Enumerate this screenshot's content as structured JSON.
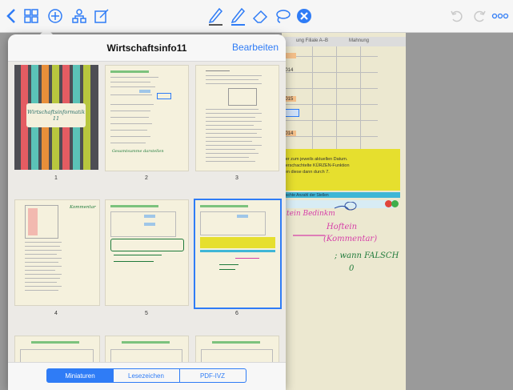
{
  "popover": {
    "title": "Wirtschaftsinfo11",
    "edit_label": "Bearbeiten",
    "tabs": [
      "Miniaturen",
      "Lesezeichen",
      "PDF-IVZ"
    ],
    "selected_tab": "Miniaturen",
    "pages": [
      {
        "number": "1",
        "cover_text": "Wirtschaftsinformatik 11"
      },
      {
        "number": "2",
        "note": "Gesamtsumme darstellen"
      },
      {
        "number": "3"
      },
      {
        "number": "4",
        "note": "Kommentar"
      },
      {
        "number": "5"
      },
      {
        "number": "6",
        "selected": true
      }
    ],
    "selected_page": "6"
  },
  "toolbar": {
    "icons": [
      "back-chevron-icon",
      "thumbnails-grid-icon",
      "add-circle-icon",
      "sitemap-icon",
      "edit-page-icon",
      "pencil-icon",
      "highlighter-icon",
      "eraser-icon",
      "lasso-icon",
      "close-circle-icon",
      "undo-icon",
      "redo-icon",
      "more-icon"
    ],
    "accent": "#2f7cf6"
  },
  "background_document": {
    "header_cells": [
      "ung Filiale A–B",
      "Mahnung"
    ],
    "numbers": [
      "2014",
      "2015",
      "1014"
    ],
    "yellow_text": [
      "ser zum jeweils aktuellen Datum.",
      "verschachtelte KÜRZEN-Funktion",
      "ren diese dann durch 7."
    ],
    "cyan_text": "rtschte Anzahl der Stellen",
    "handwriting": [
      "tein Bedinkm",
      "Hoftein",
      "(Kommentar)",
      "; wann FALSCH",
      "0"
    ],
    "handwriting_colors": {
      "pink": "#d63fa8",
      "green": "#1f7a3a"
    }
  }
}
